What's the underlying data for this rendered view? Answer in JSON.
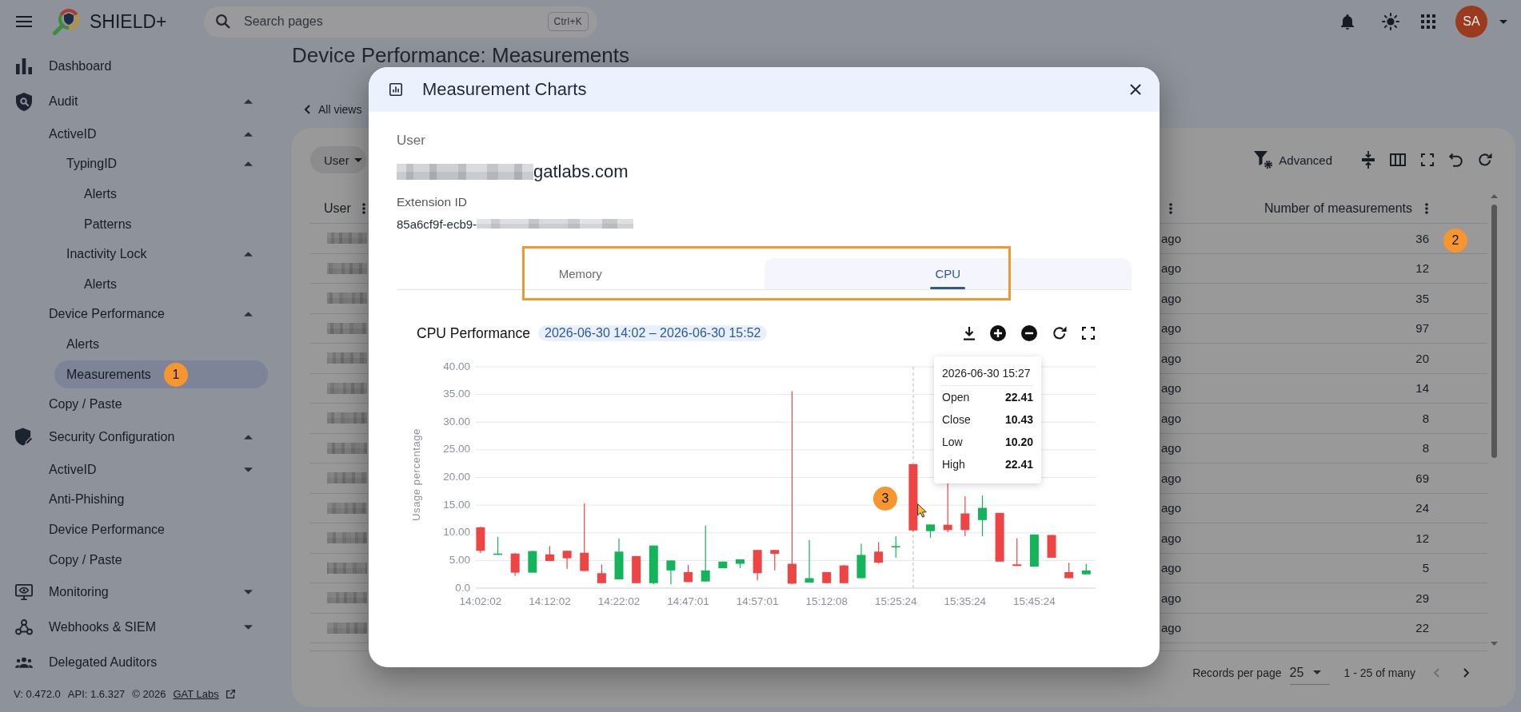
{
  "top_bar": {
    "app_name": "SHIELD+",
    "search": {
      "placeholder": "Search pages",
      "shortcut": "Ctrl+K"
    },
    "avatar_initials": "SA"
  },
  "sidebar": {
    "items": [
      {
        "label": "Dashboard",
        "selected": false
      },
      {
        "label": "Audit",
        "selected": false,
        "expanded": true,
        "children": [
          {
            "label": "ActiveID",
            "selected": false,
            "expanded": true,
            "children": [
              {
                "label": "TypingID",
                "selected": false,
                "expanded": true,
                "children": [
                  {
                    "label": "Alerts",
                    "selected": false
                  },
                  {
                    "label": "Patterns",
                    "selected": false
                  }
                ]
              },
              {
                "label": "Inactivity Lock",
                "selected": false,
                "expanded": true,
                "children": [
                  {
                    "label": "Alerts",
                    "selected": false
                  }
                ]
              }
            ]
          },
          {
            "label": "Device Performance",
            "selected": false,
            "expanded": true,
            "children": [
              {
                "label": "Alerts",
                "selected": false
              },
              {
                "label": "Measurements",
                "selected": true,
                "marker": "1"
              }
            ]
          },
          {
            "label": "Copy / Paste",
            "selected": false
          }
        ]
      },
      {
        "label": "Security Configuration",
        "selected": false,
        "expanded": true,
        "children": [
          {
            "label": "ActiveID",
            "selected": false,
            "expanded": false
          },
          {
            "label": "Anti-Phishing",
            "selected": false
          },
          {
            "label": "Device Performance",
            "selected": false
          },
          {
            "label": "Copy / Paste",
            "selected": false
          }
        ]
      },
      {
        "label": "Monitoring",
        "selected": false,
        "expanded": false
      },
      {
        "label": "Webhooks & SIEM",
        "selected": false,
        "expanded": false
      },
      {
        "label": "Delegated Auditors",
        "selected": false
      }
    ],
    "footer": {
      "version": "V: 0.472.0",
      "api": "API: 1.6.327",
      "copyright": "© 2026",
      "link": "GAT Labs"
    }
  },
  "page": {
    "title": "Device Performance: Measurements",
    "back_link": "All views",
    "filter_chip": "User",
    "advanced_button": "Advanced",
    "table": {
      "columns": [
        {
          "label": "User"
        },
        {
          "label": "Number of measurements"
        }
      ],
      "rows": [
        {
          "column_2": "ago",
          "measurements": "36",
          "marker": "2"
        },
        {
          "column_2": "ago",
          "measurements": "12"
        },
        {
          "column_2": "ago",
          "measurements": "35"
        },
        {
          "column_2": "ago",
          "measurements": "97"
        },
        {
          "column_2": "ago",
          "measurements": "20"
        },
        {
          "column_2": "ago",
          "measurements": "14"
        },
        {
          "column_2": "ago",
          "measurements": "8"
        },
        {
          "column_2": "ago",
          "measurements": "8"
        },
        {
          "column_2": "ago",
          "measurements": "69"
        },
        {
          "column_2": "ago",
          "measurements": "24"
        },
        {
          "column_2": "ago",
          "measurements": "12"
        },
        {
          "column_2": "ago",
          "measurements": "5"
        },
        {
          "column_2": "ago",
          "measurements": "29"
        },
        {
          "column_2": "ago",
          "measurements": "22"
        }
      ]
    },
    "pagination": {
      "rows_per_page_label": "Records per page",
      "rows_per_page": "25",
      "range": "1 - 25 of many",
      "previous_disabled": true,
      "next_disabled": false
    }
  },
  "modal": {
    "title": "Measurement Charts",
    "user_label": "User",
    "user_email": "gatlabs.com",
    "extension_id_label": "Extension ID",
    "extension_id": "85a6cf9f-ecb9-",
    "tabs_highlighted": true,
    "tabs": [
      {
        "label": "Memory",
        "selected": false
      },
      {
        "label": "CPU",
        "selected": true
      }
    ],
    "chart": {
      "title": "CPU Performance",
      "date_range": "2026-06-30 14:02 – 2026-06-30 15:52",
      "tooltip": {
        "time": "2026-06-30 15:27",
        "rows": [
          {
            "label": "Open",
            "value": "22.41"
          },
          {
            "label": "Close",
            "value": "10.43"
          },
          {
            "label": "Low",
            "value": "10.20"
          },
          {
            "label": "High",
            "value": "22.41"
          }
        ]
      },
      "marker": "3",
      "chart_data": {
        "type": "candlestick",
        "ylabel": "Usage percentage",
        "grid": true,
        "categories": [
          "14:02:02",
          null,
          null,
          null,
          "14:12:02",
          null,
          null,
          null,
          "14:22:02",
          null,
          null,
          null,
          "14:47:01",
          null,
          null,
          null,
          "14:57:01",
          null,
          null,
          null,
          "15:12:08",
          null,
          null,
          null,
          "15:25:24",
          null,
          null,
          null,
          "15:35:24",
          null,
          null,
          null,
          "15:45:24",
          null,
          null,
          null
        ],
        "ohlc": [
          [
            11.0,
            11.1,
            6.3,
            6.75
          ],
          [
            6.15,
            9.3,
            6.0,
            6.25
          ],
          [
            6.25,
            6.3,
            2.2,
            2.8
          ],
          [
            2.8,
            6.75,
            2.8,
            6.7
          ],
          [
            6.1,
            7.6,
            4.9,
            4.9
          ],
          [
            6.75,
            6.75,
            3.5,
            5.4
          ],
          [
            6.4,
            15.3,
            3.1,
            3.1
          ],
          [
            2.7,
            4.3,
            0.9,
            0.9
          ],
          [
            1.6,
            9.0,
            1.6,
            6.6
          ],
          [
            5.8,
            5.8,
            0.9,
            0.9
          ],
          [
            0.9,
            7.7,
            0.7,
            7.7
          ],
          [
            3.2,
            5.0,
            0.7,
            5.0
          ],
          [
            2.9,
            4.2,
            1.1,
            1.1
          ],
          [
            1.2,
            11.3,
            1.2,
            3.2
          ],
          [
            3.6,
            4.8,
            3.6,
            4.8
          ],
          [
            4.4,
            5.2,
            3.6,
            5.2
          ],
          [
            6.9,
            6.9,
            1.4,
            2.7
          ],
          [
            6.9,
            6.9,
            3.2,
            6.2
          ],
          [
            4.4,
            35.6,
            0.8,
            0.8
          ],
          [
            1.0,
            8.7,
            1.0,
            1.8
          ],
          [
            2.9,
            2.9,
            0.9,
            0.9
          ],
          [
            4.1,
            4.2,
            0.9,
            0.9
          ],
          [
            1.8,
            8.0,
            1.8,
            6.0
          ],
          [
            6.6,
            8.3,
            4.4,
            4.6
          ],
          [
            7.4,
            9.4,
            5.5,
            7.6
          ],
          [
            22.41,
            22.41,
            10.2,
            10.43
          ],
          [
            10.3,
            11.5,
            9.1,
            11.5
          ],
          [
            11.45,
            19.1,
            10.1,
            10.5
          ],
          [
            13.5,
            16.6,
            9.4,
            10.5
          ],
          [
            12.3,
            16.75,
            9.4,
            14.5
          ],
          [
            13.6,
            13.6,
            4.8,
            4.8
          ],
          [
            4.3,
            9.0,
            4.0,
            4.0
          ],
          [
            3.9,
            9.7,
            3.9,
            9.7
          ],
          [
            9.6,
            9.6,
            5.5,
            5.5
          ],
          [
            2.9,
            4.6,
            1.8,
            1.8
          ],
          [
            2.5,
            4.4,
            2.5,
            3.2
          ]
        ],
        "ylim": [
          0,
          40
        ],
        "yticks": [
          {
            "value": 40,
            "label": "40.00"
          },
          {
            "value": 35,
            "label": "35.00"
          },
          {
            "value": 30,
            "label": "30.00"
          },
          {
            "value": 25,
            "label": "25.00"
          },
          {
            "value": 20,
            "label": "20.00"
          },
          {
            "value": 15,
            "label": "15.00"
          },
          {
            "value": 10,
            "label": "10.00"
          },
          {
            "value": 5,
            "label": "5.00"
          },
          {
            "value": 0,
            "label": "0.0"
          }
        ]
      }
    }
  }
}
